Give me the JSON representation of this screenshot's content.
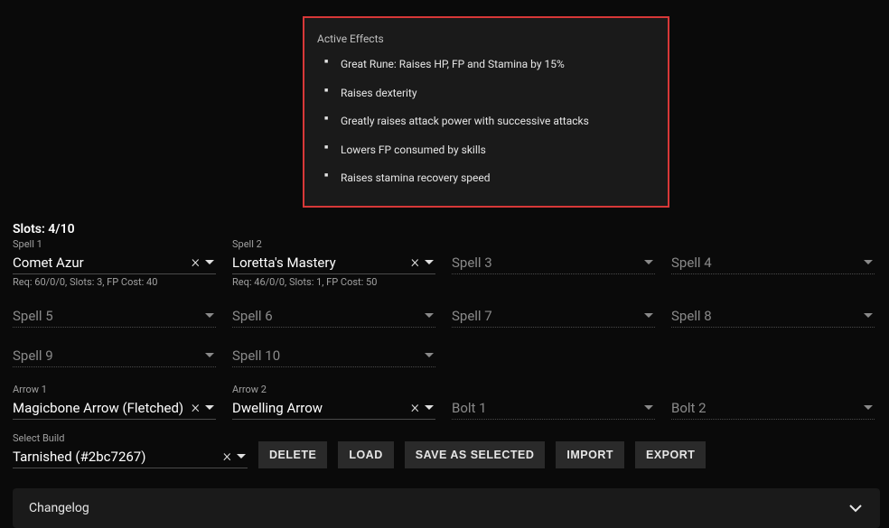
{
  "effects": {
    "title": "Active Effects",
    "items": [
      "Great Rune: Raises HP, FP and Stamina by 15%",
      "Raises dexterity",
      "Greatly raises attack power with successive attacks",
      "Lowers FP consumed by skills",
      "Raises stamina recovery speed"
    ]
  },
  "slots_header": "Slots: 4/10",
  "spells": [
    {
      "label": "Spell 1",
      "value": "Comet Azur",
      "req": "Req: 60/0/0, Slots: 3, FP Cost: 40",
      "filled": true
    },
    {
      "label": "Spell 2",
      "value": "Loretta's Mastery",
      "req": "Req: 46/0/0, Slots: 1, FP Cost: 50",
      "filled": true
    },
    {
      "label": "Spell 3",
      "value": "Spell 3",
      "req": "",
      "filled": false
    },
    {
      "label": "Spell 4",
      "value": "Spell 4",
      "req": "",
      "filled": false
    },
    {
      "label": "Spell 5",
      "value": "Spell 5",
      "req": "",
      "filled": false
    },
    {
      "label": "Spell 6",
      "value": "Spell 6",
      "req": "",
      "filled": false
    },
    {
      "label": "Spell 7",
      "value": "Spell 7",
      "req": "",
      "filled": false
    },
    {
      "label": "Spell 8",
      "value": "Spell 8",
      "req": "",
      "filled": false
    },
    {
      "label": "Spell 9",
      "value": "Spell 9",
      "req": "",
      "filled": false
    },
    {
      "label": "Spell 10",
      "value": "Spell 10",
      "req": "",
      "filled": false
    }
  ],
  "arrows": [
    {
      "label": "Arrow 1",
      "value": "Magicbone Arrow (Fletched)",
      "filled": true
    },
    {
      "label": "Arrow 2",
      "value": "Dwelling Arrow",
      "filled": true
    },
    {
      "label": "Bolt 1",
      "value": "Bolt 1",
      "filled": false
    },
    {
      "label": "Bolt 2",
      "value": "Bolt 2",
      "filled": false
    }
  ],
  "build": {
    "label": "Select Build",
    "value": "Tarnished (#2bc7267)"
  },
  "buttons": {
    "delete": "DELETE",
    "load": "LOAD",
    "save": "SAVE AS SELECTED",
    "import": "IMPORT",
    "export": "EXPORT"
  },
  "changelog": "Changelog"
}
